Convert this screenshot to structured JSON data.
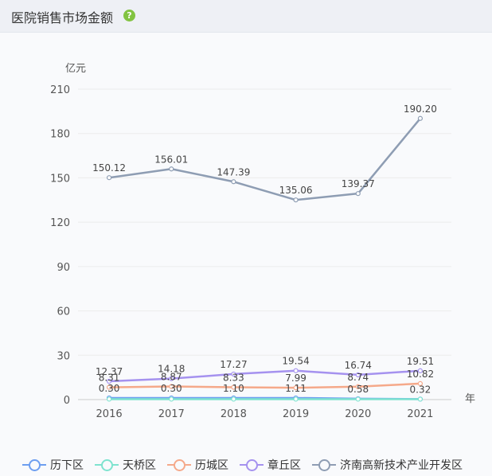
{
  "header": {
    "title": "医院销售市场金额",
    "help_icon": "question-circle-icon"
  },
  "chart_data": {
    "type": "line",
    "title": "",
    "ylabel": "亿元",
    "xlabel": "年",
    "categories": [
      "2016",
      "2017",
      "2018",
      "2019",
      "2020",
      "2021"
    ],
    "ylim": [
      0,
      210
    ],
    "yticks": [
      0,
      30,
      60,
      90,
      120,
      150,
      180,
      210
    ],
    "grid": true,
    "legend_position": "bottom",
    "series": [
      {
        "name": "历下区",
        "color": "#6d9ef0",
        "values": [
          1.11,
          1.11,
          1.11,
          1.11,
          0.58,
          0.32
        ]
      },
      {
        "name": "天桥区",
        "color": "#7ee3cf",
        "values": [
          0.3,
          0.3,
          0.3,
          0.3,
          0.3,
          0.3
        ]
      },
      {
        "name": "历城区",
        "color": "#f5a98a",
        "values": [
          8.31,
          8.87,
          8.33,
          7.99,
          8.74,
          10.82
        ]
      },
      {
        "name": "章丘区",
        "color": "#a592ef",
        "values": [
          12.37,
          14.18,
          17.27,
          19.54,
          16.74,
          19.51
        ]
      },
      {
        "name": "济南高新技术产业开发区",
        "color": "#8e9db3",
        "values": [
          150.12,
          156.01,
          147.39,
          135.06,
          139.37,
          190.2
        ]
      }
    ],
    "data_labels": [
      {
        "series": 4,
        "index": 0,
        "text": "150.12"
      },
      {
        "series": 4,
        "index": 1,
        "text": "156.01"
      },
      {
        "series": 4,
        "index": 2,
        "text": "147.39"
      },
      {
        "series": 4,
        "index": 3,
        "text": "135.06"
      },
      {
        "series": 4,
        "index": 4,
        "text": "139.37"
      },
      {
        "series": 4,
        "index": 5,
        "text": "190.20"
      },
      {
        "series": 3,
        "index": 0,
        "text": "12.37"
      },
      {
        "series": 3,
        "index": 1,
        "text": "14.18"
      },
      {
        "series": 3,
        "index": 2,
        "text": "17.27"
      },
      {
        "series": 3,
        "index": 3,
        "text": "19.54"
      },
      {
        "series": 3,
        "index": 4,
        "text": "16.74"
      },
      {
        "series": 3,
        "index": 5,
        "text": "19.51"
      },
      {
        "series": 2,
        "index": 0,
        "text": "8.31"
      },
      {
        "series": 2,
        "index": 1,
        "text": "8.87"
      },
      {
        "series": 2,
        "index": 2,
        "text": "8.33"
      },
      {
        "series": 2,
        "index": 3,
        "text": "7.99"
      },
      {
        "series": 2,
        "index": 4,
        "text": "8.74"
      },
      {
        "series": 2,
        "index": 5,
        "text": "10.82"
      },
      {
        "series": 0,
        "index": 0,
        "text": "0.30"
      },
      {
        "series": 0,
        "index": 1,
        "text": "0.30"
      },
      {
        "series": 0,
        "index": 2,
        "text": "1.10"
      },
      {
        "series": 0,
        "index": 3,
        "text": "1.11"
      },
      {
        "series": 0,
        "index": 4,
        "text": "0.58"
      },
      {
        "series": 0,
        "index": 5,
        "text": "0.32"
      }
    ]
  }
}
